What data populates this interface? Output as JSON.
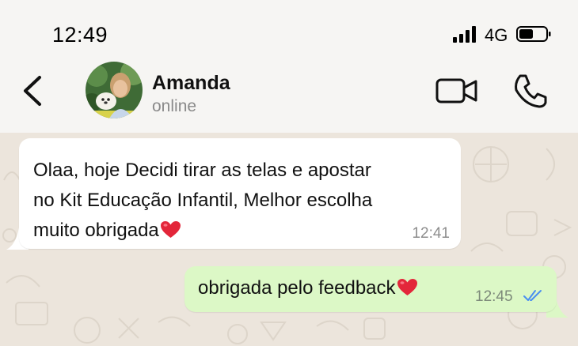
{
  "status_bar": {
    "time": "12:49",
    "network": "4G",
    "icons": [
      "signal-icon",
      "battery-icon"
    ]
  },
  "header": {
    "back_icon": "chevron-left-icon",
    "contact_name": "Amanda",
    "contact_status": "online",
    "video_icon": "video-camera-icon",
    "call_icon": "phone-icon"
  },
  "messages": [
    {
      "direction": "incoming",
      "lines": [
        "Olaa, hoje Decidi tirar as telas e apostar",
        "no Kit Educação Infantil, Melhor escolha",
        "muito obrigada"
      ],
      "emoji": "heart-emoji",
      "time": "12:41"
    },
    {
      "direction": "outgoing",
      "text": "obrigada pelo feedback",
      "emoji": "heart-emoji",
      "time": "12:45",
      "status_icon": "double-check-read-icon"
    }
  ],
  "colors": {
    "outgoing_bubble": "#dcf8c6",
    "incoming_bubble": "#ffffff",
    "chat_background": "#ece5dc",
    "read_ticks": "#4a8ff0",
    "heart": "#e3263a"
  }
}
